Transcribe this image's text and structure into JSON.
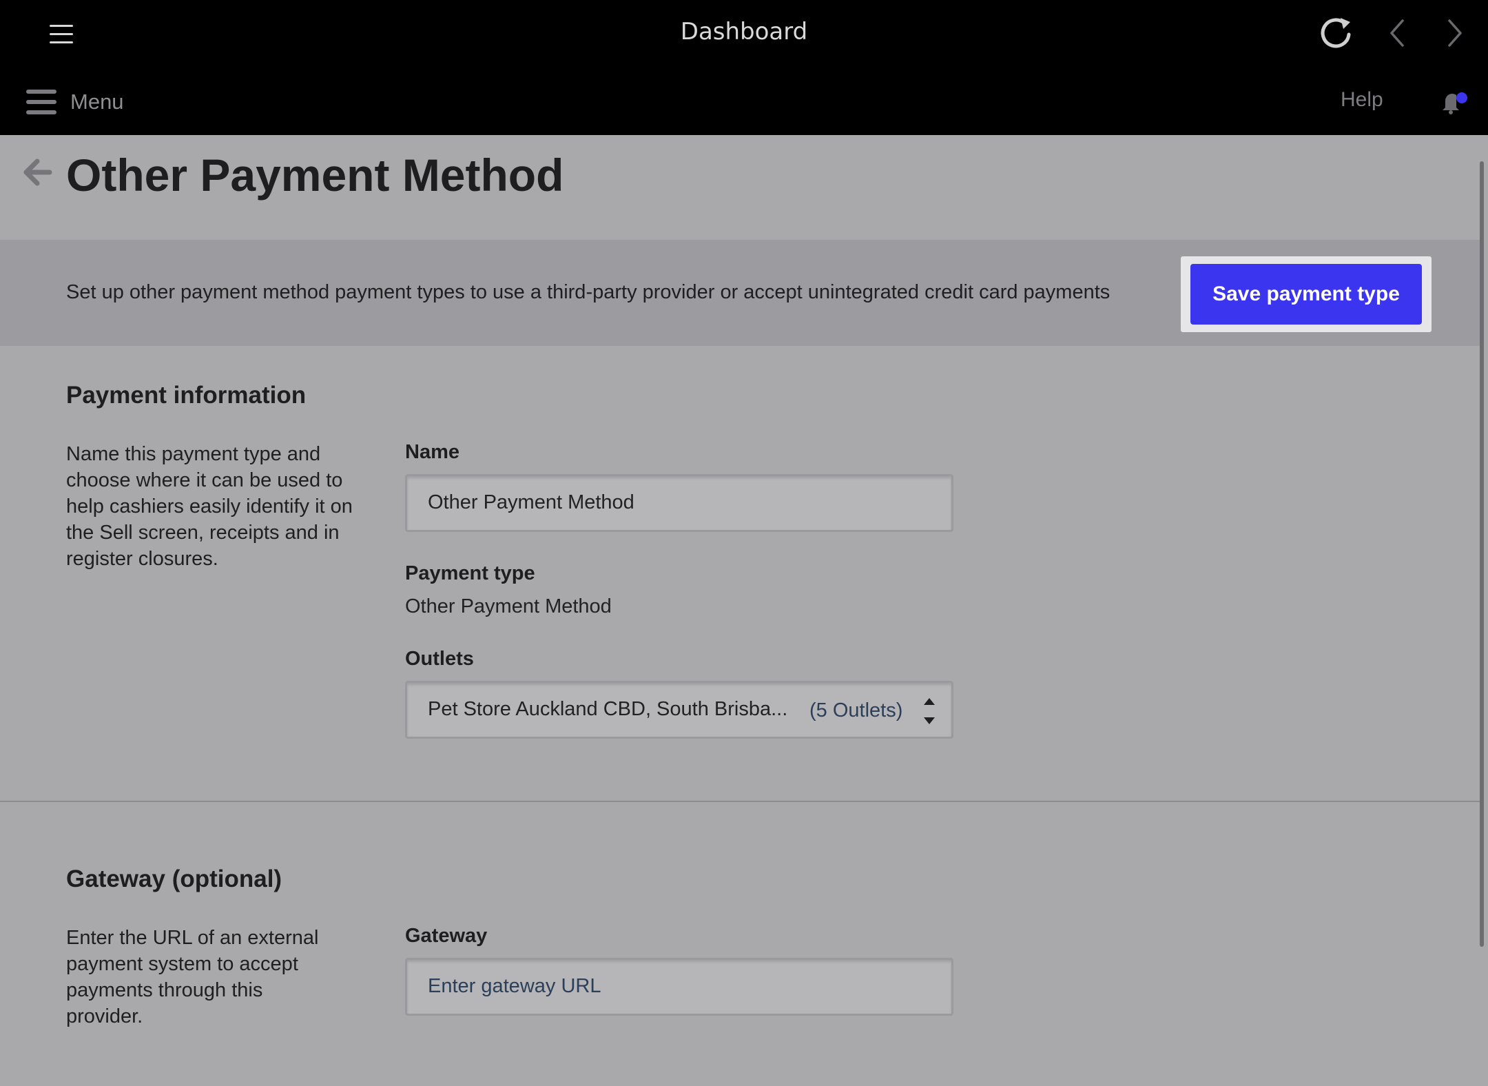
{
  "appbar": {
    "title": "Dashboard",
    "icons": [
      "hamburger-icon",
      "refresh-icon",
      "chevron-left-icon",
      "chevron-right-icon"
    ]
  },
  "navbar": {
    "menu_label": "Menu",
    "help_label": "Help",
    "notification_dot_color": "#3b35f0"
  },
  "page": {
    "title": "Other Payment Method"
  },
  "banner": {
    "text": "Set up other payment method payment types to use a third-party provider or accept unintegrated credit card payments",
    "save_label": "Save payment type",
    "accent_color": "#3b35f0"
  },
  "payment_info": {
    "title": "Payment information",
    "description": "Name this payment type and choose where it can be used to help cashiers easily identify it on the Sell screen, receipts and in register closures.",
    "name_label": "Name",
    "name_value": "Other Payment Method",
    "type_label": "Payment type",
    "type_value": "Other Payment Method",
    "outlets_label": "Outlets",
    "outlets_value": "Pet Store Auckland CBD, South Brisba...",
    "outlets_count": "(5 Outlets)"
  },
  "gateway": {
    "title": "Gateway (optional)",
    "description": "Enter the URL of an external payment system to accept payments through this provider.",
    "label": "Gateway",
    "placeholder": "Enter gateway URL"
  }
}
